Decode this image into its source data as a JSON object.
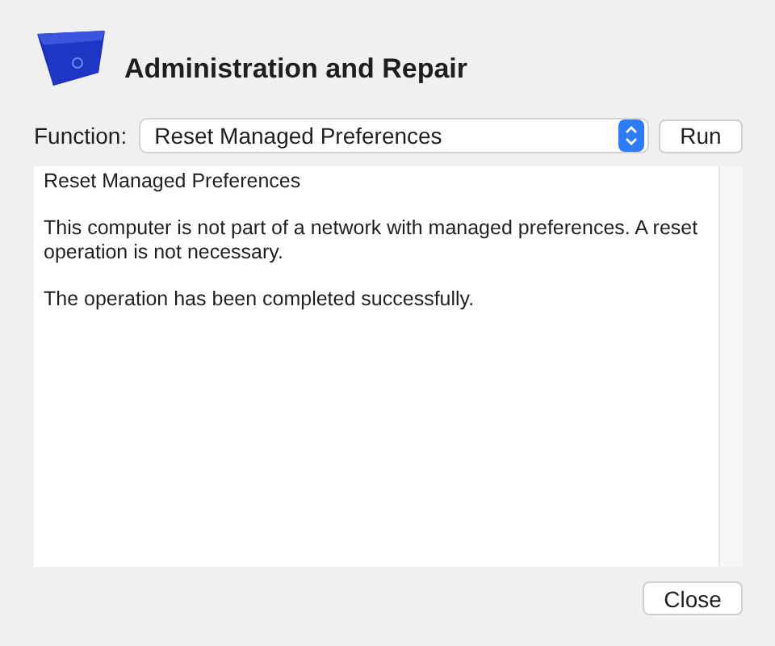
{
  "window": {
    "title": "Administration and Repair"
  },
  "function": {
    "label": "Function:",
    "value": "Reset Managed Preferences"
  },
  "run_button": "Run",
  "log": [
    "Reset Managed Preferences",
    "This computer is not part of a network with managed preferences. A reset operation is not necessary.",
    "The operation has been completed successfully."
  ],
  "buttons": [
    "Close"
  ]
}
